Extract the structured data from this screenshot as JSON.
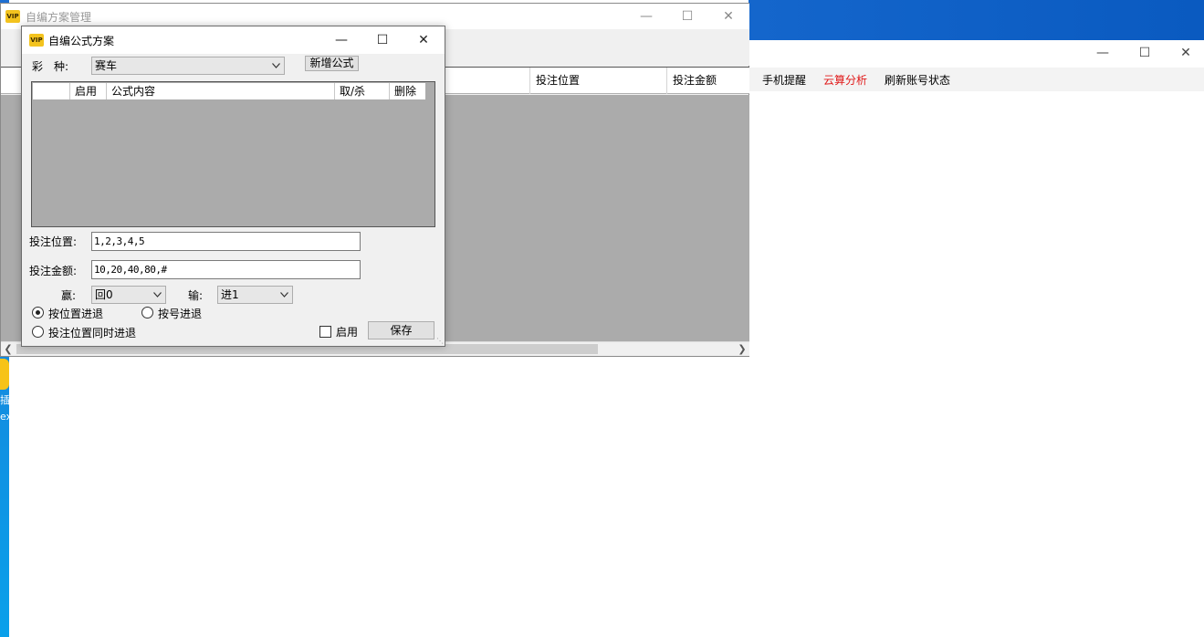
{
  "colors": {
    "accent": "#1f6fd0",
    "red_menu": "#e01818",
    "grid_bg": "#ababab"
  },
  "desktop": {
    "icon_text": "插",
    "icon_text2": "ex"
  },
  "main_window": {
    "menu": [
      {
        "label": "手机提醒"
      },
      {
        "label": "云算分析",
        "color": "red"
      },
      {
        "label": "刷新账号状态"
      }
    ]
  },
  "manager": {
    "title": "自编方案管理",
    "columns": [
      {
        "label": ""
      },
      {
        "label": "投注位置"
      },
      {
        "label": "投注金额"
      }
    ]
  },
  "dialog": {
    "title": "自编公式方案",
    "lottery_label": "彩　种:",
    "lottery_value": "赛车",
    "add_formula_button": "新增公式",
    "list_headers": [
      "",
      "启用",
      "公式内容",
      "取/杀",
      "删除"
    ],
    "position_label": "投注位置:",
    "position_value": "1,2,3,4,5",
    "amount_label": "投注金额:",
    "amount_value": "10,20,40,80,#",
    "win_label": "赢:",
    "win_value": "回0",
    "lose_label": "输:",
    "lose_value": "进1",
    "radio_by_position": "按位置进退",
    "radio_by_number": "按号进退",
    "radio_sync": "投注位置同时进退",
    "enable_label": "启用",
    "save_button": "保存"
  }
}
